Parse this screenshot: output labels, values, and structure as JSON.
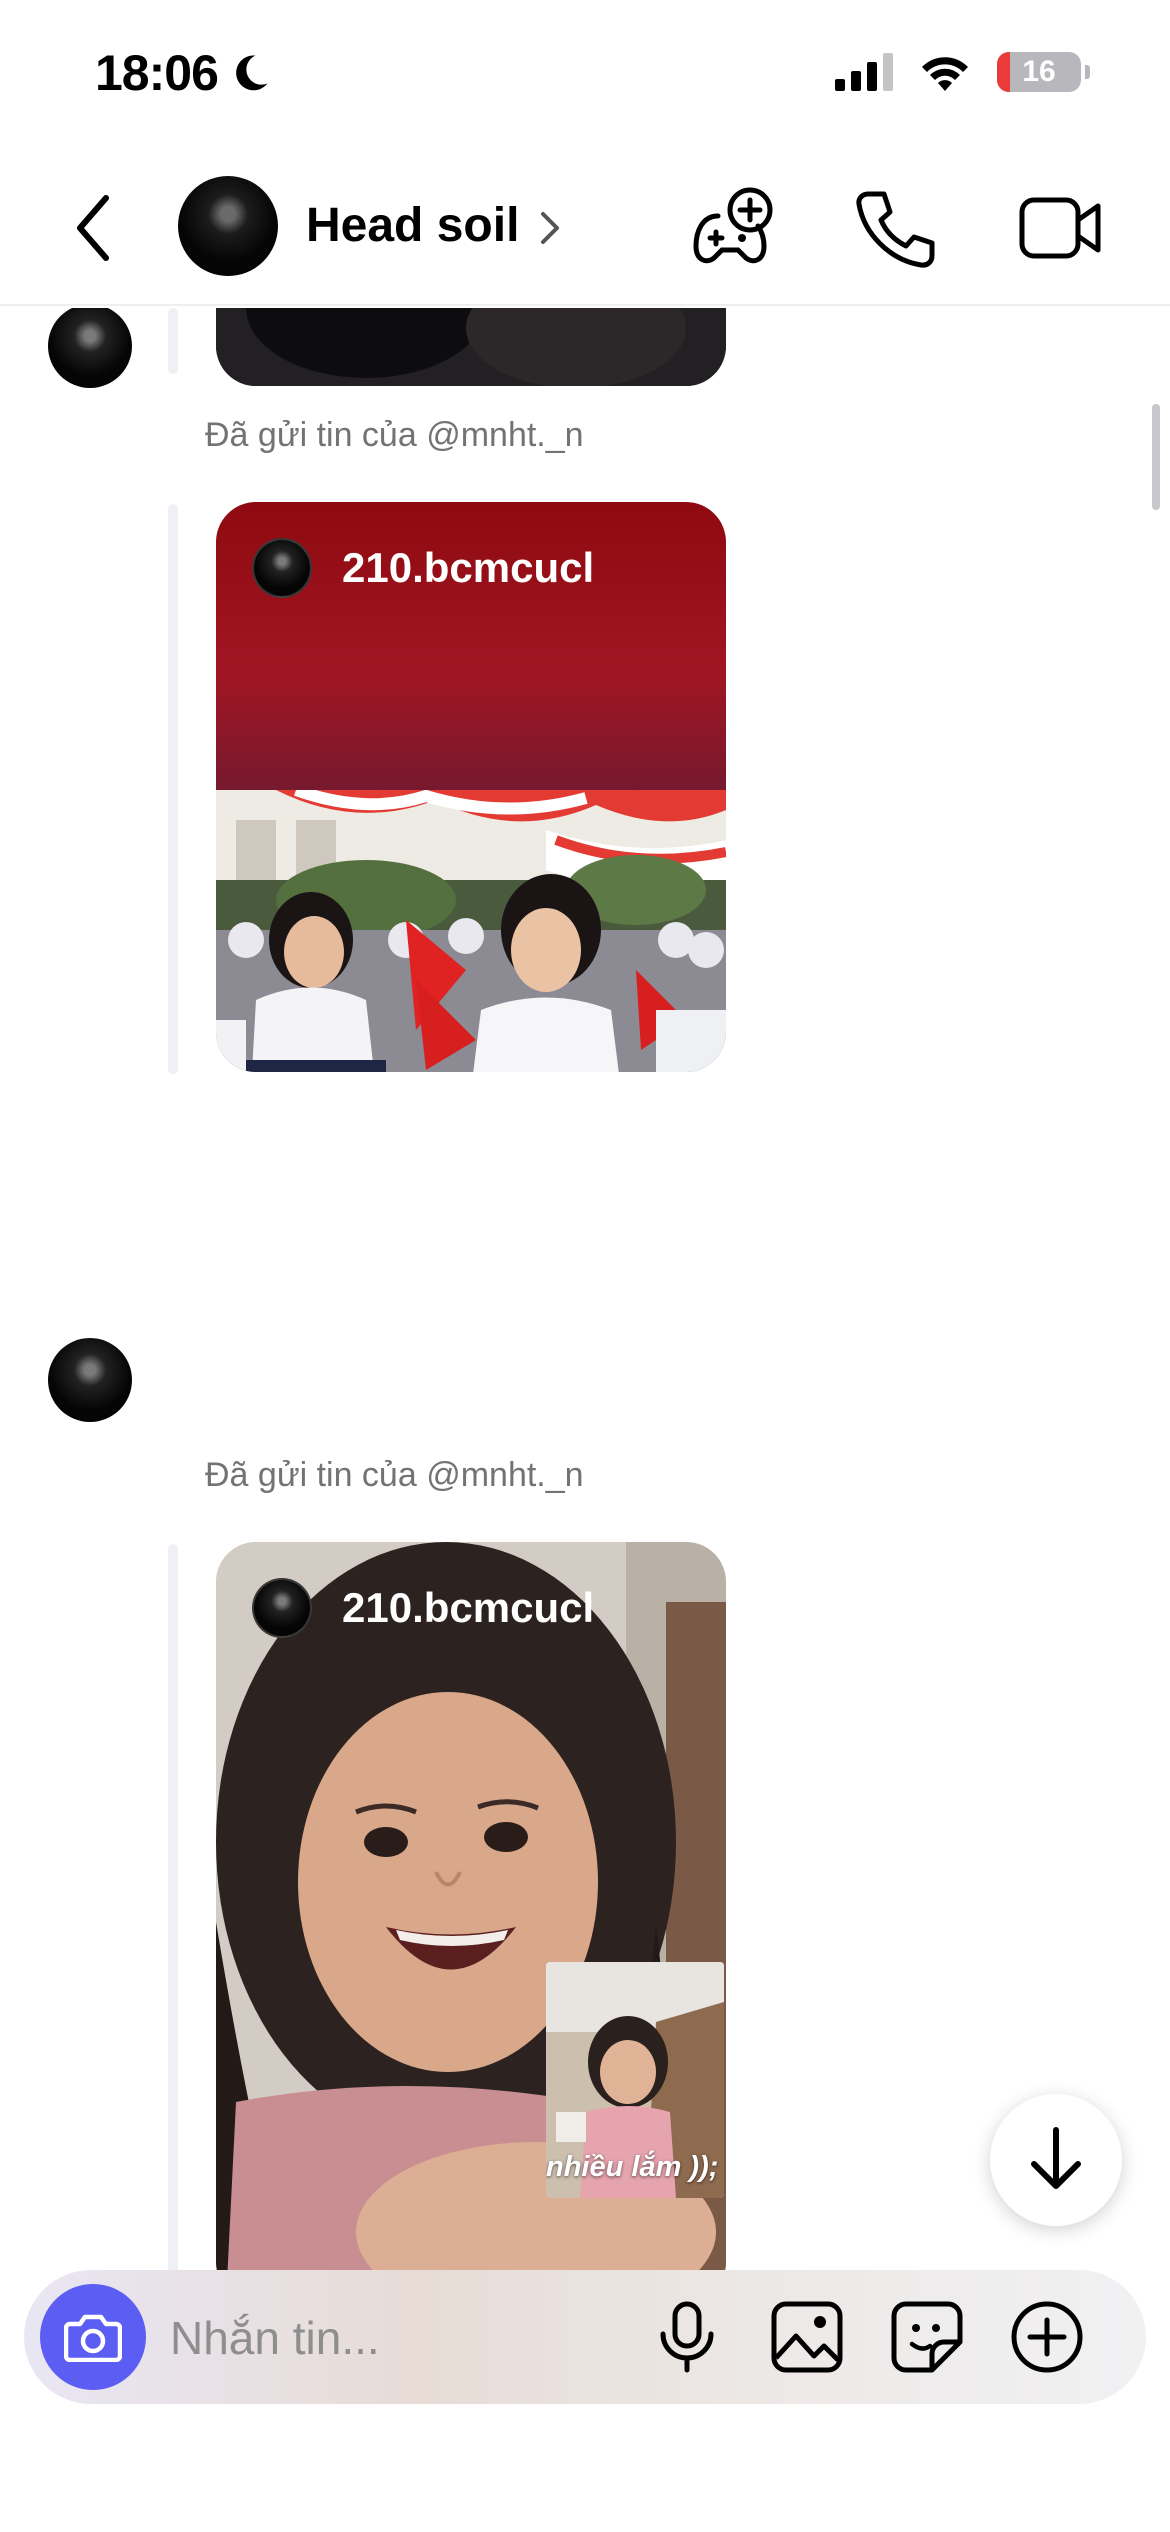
{
  "status_bar": {
    "time": "18:06",
    "battery": "16",
    "battery_level": 0.16,
    "icons": [
      "moon-icon",
      "cellular-signal-icon",
      "wifi-icon",
      "battery-icon"
    ]
  },
  "header": {
    "contact_name": "Head soil",
    "icons": [
      "back-chevron-icon",
      "avatar",
      "chevron-right-icon",
      "game-add-icon",
      "phone-icon",
      "video-camera-icon"
    ]
  },
  "messages": [
    {
      "caption": "Đã gửi tin của @mnht._n",
      "story_user": "210.bcmcucl"
    },
    {
      "caption": "Đã gửi tin của @mnht._n",
      "story_user": "210.bcmcucl",
      "overlay_text": "nhiều lắm ));"
    }
  ],
  "composer": {
    "placeholder": "Nhắn tin...",
    "icons": [
      "camera-icon",
      "microphone-icon",
      "gallery-icon",
      "sticker-icon",
      "plus-circle-icon"
    ]
  },
  "colors": {
    "accent": "#5c5ef3",
    "caption": "#737373",
    "battery_low": "#ea3a3a"
  }
}
